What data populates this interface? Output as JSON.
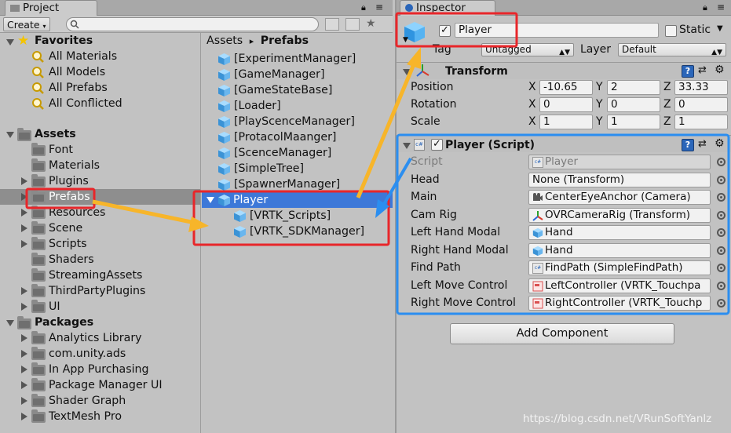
{
  "project": {
    "tab_label": "Project",
    "create_label": "Create",
    "search_placeholder": "",
    "favorites": {
      "label": "Favorites",
      "items": [
        "All Materials",
        "All Models",
        "All Prefabs",
        "All Conflicted"
      ]
    },
    "assets": {
      "label": "Assets",
      "items": [
        "Font",
        "Materials",
        "Plugins",
        "Prefabs",
        "Resources",
        "Scene",
        "Scripts",
        "Shaders",
        "StreamingAssets",
        "ThirdPartyPlugins",
        "UI"
      ],
      "selected": "Prefabs"
    },
    "packages": {
      "label": "Packages",
      "items": [
        "Analytics Library",
        "com.unity.ads",
        "In App Purchasing",
        "Package Manager UI",
        "Shader Graph",
        "TextMesh Pro"
      ]
    },
    "breadcrumb": {
      "root": "Assets",
      "separator": "▸",
      "current": "Prefabs"
    },
    "prefabs": [
      "[ExperimentManager]",
      "[GameManager]",
      "[GameStateBase]",
      "[Loader]",
      "[PlayScenceManager]",
      "[ProtacolMaanger]",
      "[ScenceManager]",
      "[SimpleTree]",
      "[SpawnerManager]"
    ],
    "player": {
      "label": "Player",
      "children": [
        "[VRTK_Scripts]",
        "[VRTK_SDKManager]"
      ]
    }
  },
  "inspector": {
    "tab_label": "Inspector",
    "object_name": "Player",
    "active_checked": true,
    "static_label": "Static",
    "tag_label": "Tag",
    "tag_value": "Untagged",
    "layer_label": "Layer",
    "layer_value": "Default",
    "transform": {
      "title": "Transform",
      "position": {
        "label": "Position",
        "x": "-10.65",
        "y": "2",
        "z": "33.33"
      },
      "rotation": {
        "label": "Rotation",
        "x": "0",
        "y": "0",
        "z": "0"
      },
      "scale": {
        "label": "Scale",
        "x": "1",
        "y": "1",
        "z": "1"
      },
      "axis_x": "X",
      "axis_y": "Y",
      "axis_z": "Z"
    },
    "script_component": {
      "title": "Player (Script)",
      "enabled": true,
      "fields": [
        {
          "label": "Script",
          "value": "Player",
          "icon": "script-icon"
        },
        {
          "label": "Head",
          "value": "None (Transform)",
          "icon": ""
        },
        {
          "label": "Main",
          "value": "CenterEyeAnchor (Camera)",
          "icon": "camera-icon"
        },
        {
          "label": "Cam Rig",
          "value": "OVRCameraRig (Transform)",
          "icon": "transform-icon"
        },
        {
          "label": "Left Hand Modal",
          "value": "Hand",
          "icon": "cube-icon"
        },
        {
          "label": "Right Hand Modal",
          "value": "Hand",
          "icon": "cube-icon"
        },
        {
          "label": "Find Path",
          "value": "FindPath (SimpleFindPath)",
          "icon": "script-icon"
        },
        {
          "label": "Left Move Control",
          "value": "LeftController (VRTK_Touchpa",
          "icon": "controller-icon"
        },
        {
          "label": "Right Move Control",
          "value": "RightController (VRTK_Touchp",
          "icon": "controller-icon"
        }
      ]
    },
    "add_component_label": "Add Component"
  },
  "watermark": "https://blog.csdn.net/VRunSoftYanlz",
  "colors": {
    "selection_blue": "#3d78d8",
    "annotation_red": "#e8262a",
    "annotation_blue": "#2b8ef0",
    "annotation_yellow": "#f7b52a"
  }
}
